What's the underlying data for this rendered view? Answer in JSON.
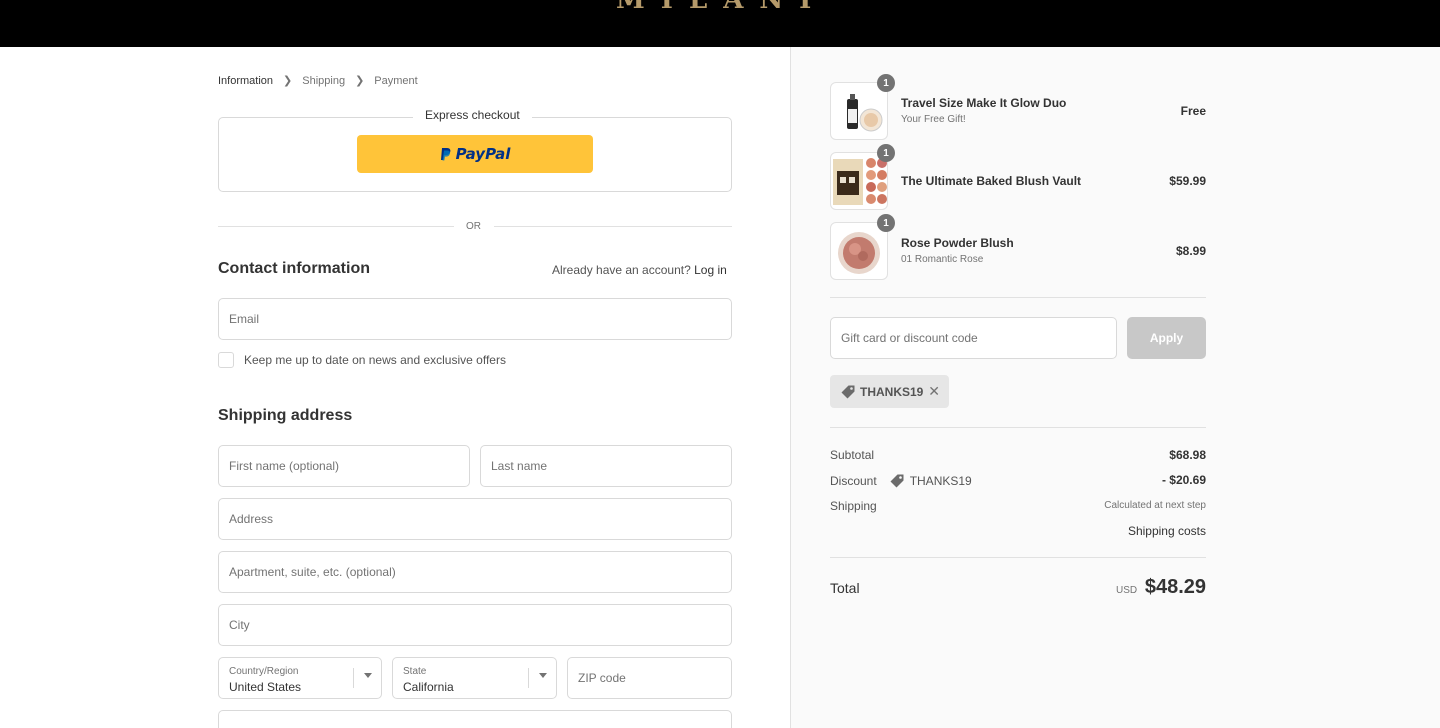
{
  "brand": {
    "logo_text": "MILANI"
  },
  "breadcrumb": {
    "items": [
      "Information",
      "Shipping",
      "Payment"
    ]
  },
  "express": {
    "title": "Express checkout",
    "paypal_label": "PayPal",
    "separator": "OR"
  },
  "contact": {
    "title": "Contact information",
    "account_prompt": "Already have an account?",
    "login_link": "Log in",
    "email_placeholder": "Email",
    "newsletter_label": "Keep me up to date on news and exclusive offers"
  },
  "shipping": {
    "title": "Shipping address",
    "first_name_placeholder": "First name (optional)",
    "last_name_placeholder": "Last name",
    "address_placeholder": "Address",
    "apartment_placeholder": "Apartment, suite, etc. (optional)",
    "city_placeholder": "City",
    "country": {
      "label": "Country/Region",
      "value": "United States"
    },
    "state": {
      "label": "State",
      "value": "California"
    },
    "zip_placeholder": "ZIP code"
  },
  "cart": {
    "items": [
      {
        "name": "Travel Size Make It Glow Duo",
        "variant": "Your Free Gift!",
        "price": "Free",
        "qty": "1"
      },
      {
        "name": "The Ultimate Baked Blush Vault",
        "variant": "",
        "price": "$59.99",
        "qty": "1"
      },
      {
        "name": "Rose Powder Blush",
        "variant": "01 Romantic Rose",
        "price": "$8.99",
        "qty": "1"
      }
    ]
  },
  "discount": {
    "placeholder": "Gift card or discount code",
    "apply_label": "Apply",
    "applied_code": "THANKS19"
  },
  "summary": {
    "subtotal_label": "Subtotal",
    "subtotal_value": "$68.98",
    "discount_label": "Discount",
    "discount_code": "THANKS19",
    "discount_value": "- $20.69",
    "shipping_label": "Shipping",
    "shipping_note": "Calculated at next step",
    "shipping_costs_label": "Shipping costs",
    "total_label": "Total",
    "currency": "USD",
    "total_value": "$48.29"
  },
  "colors": {
    "paypal_yellow": "#ffc439",
    "paypal_blue": "#003087",
    "apply_disabled": "#c8c8c8"
  }
}
